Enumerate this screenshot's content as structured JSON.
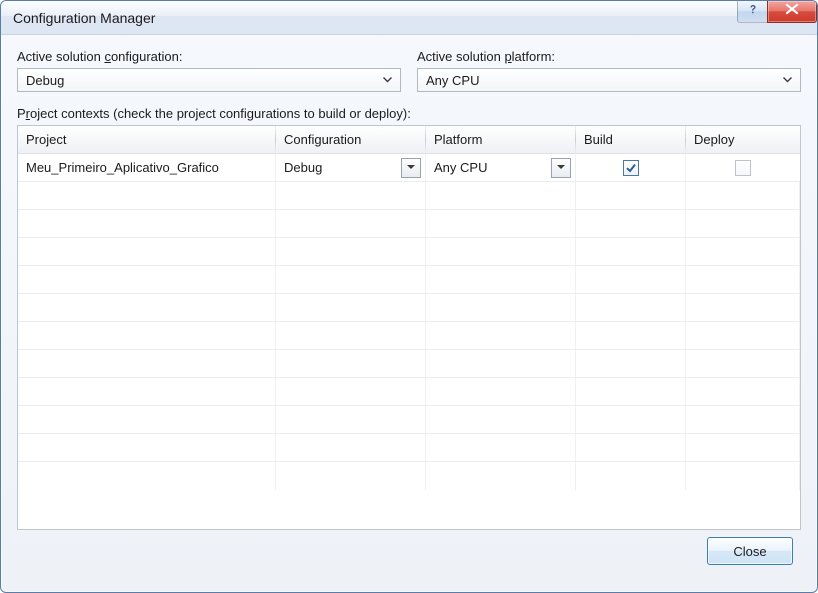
{
  "window": {
    "title": "Configuration Manager"
  },
  "fields": {
    "solution_config_label_pre": "Active solution ",
    "solution_config_label_u": "c",
    "solution_config_label_post": "onfiguration:",
    "solution_config_value": "Debug",
    "solution_platform_label_pre": "Active solution ",
    "solution_platform_label_u": "p",
    "solution_platform_label_post": "latform:",
    "solution_platform_value": "Any CPU"
  },
  "contexts": {
    "label_pre": "P",
    "label_u": "r",
    "label_post": "oject contexts (check the project configurations to build or deploy):"
  },
  "grid": {
    "headers": {
      "project": "Project",
      "configuration": "Configuration",
      "platform": "Platform",
      "build": "Build",
      "deploy": "Deploy"
    },
    "rows": [
      {
        "project": "Meu_Primeiro_Aplicativo_Grafico",
        "configuration": "Debug",
        "platform": "Any CPU",
        "build": true,
        "deploy": false,
        "deploy_enabled": false
      }
    ]
  },
  "footer": {
    "close_label": "Close"
  }
}
